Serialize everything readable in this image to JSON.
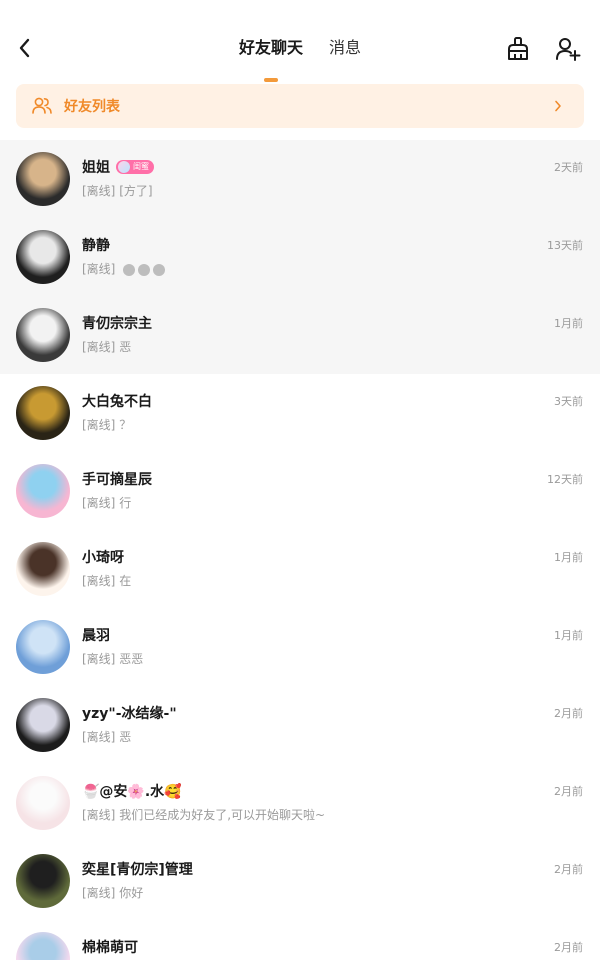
{
  "header": {
    "tabs": [
      {
        "label": "好友聊天",
        "active": true
      },
      {
        "label": "消息",
        "active": false
      }
    ]
  },
  "banner": {
    "label": "好友列表",
    "accent_color": "#f08a2a",
    "background_color": "#fff1e4"
  },
  "friends": [
    {
      "name": "姐姐",
      "status": "[离线]",
      "message": "[方了]",
      "time": "2天前",
      "pinned": true,
      "badge": "闺蜜",
      "avatar_colors": [
        "#2b2b2b",
        "#d7b48a"
      ]
    },
    {
      "name": "静静",
      "status": "[离线]",
      "message": "",
      "message_dots": 3,
      "time": "13天前",
      "pinned": true,
      "avatar_colors": [
        "#1f1f1f",
        "#e8e8e8"
      ]
    },
    {
      "name": "青仞宗宗主",
      "status": "[离线]",
      "message": "恶",
      "time": "1月前",
      "pinned": true,
      "avatar_colors": [
        "#3a3a3a",
        "#f2f2f2"
      ]
    },
    {
      "name": "大白兔不白",
      "status": "[离线]",
      "message": "？",
      "time": "3天前",
      "pinned": false,
      "avatar_colors": [
        "#2a2416",
        "#c89a32"
      ]
    },
    {
      "name": "手可摘星辰",
      "status": "[离线]",
      "message": "行",
      "time": "12天前",
      "pinned": false,
      "avatar_colors": [
        "#f7b6d2",
        "#8fd1f0"
      ]
    },
    {
      "name": "小琦呀",
      "status": "[离线]",
      "message": "在",
      "time": "1月前",
      "pinned": false,
      "avatar_colors": [
        "#fdf4ec",
        "#4a3328"
      ]
    },
    {
      "name": "晨羽",
      "status": "[离线]",
      "message": "恶恶",
      "time": "1月前",
      "pinned": false,
      "avatar_colors": [
        "#6f9fd8",
        "#cfe3f6"
      ]
    },
    {
      "name": "yzy\"-冰结缘-\"",
      "status": "[离线]",
      "message": "恶",
      "time": "2月前",
      "pinned": false,
      "avatar_colors": [
        "#1c1c1c",
        "#d9d9e6"
      ]
    },
    {
      "name": "🍧@安🌸.水🥰",
      "status": "[离线]",
      "message": "我们已经成为好友了,可以开始聊天啦~",
      "time": "2月前",
      "pinned": false,
      "avatar_colors": [
        "#f6e3e6",
        "#fbfbfb"
      ]
    },
    {
      "name": "奕星[青仞宗]管理",
      "status": "[离线]",
      "message": "你好",
      "time": "2月前",
      "pinned": false,
      "avatar_colors": [
        "#5f6a3a",
        "#1f1f1f"
      ]
    },
    {
      "name": "棉棉萌可",
      "status": "",
      "message": "",
      "time": "2月前",
      "pinned": false,
      "avatar_colors": [
        "#f3d9ee",
        "#a9cde8"
      ]
    }
  ]
}
